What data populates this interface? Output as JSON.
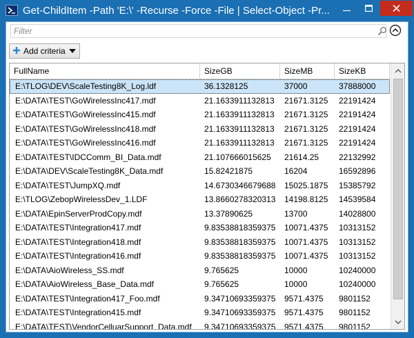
{
  "window": {
    "title": "Get-ChildItem -Path 'E:\\' -Recurse -Force -File | Select-Object -Pr...",
    "controls": [
      "minimize",
      "maximize",
      "close"
    ]
  },
  "filter": {
    "placeholder": "Filter"
  },
  "toolbar": {
    "add_criteria_label": "Add criteria"
  },
  "grid": {
    "columns": [
      "FullName",
      "SizeGB",
      "SizeMB",
      "SizeKB"
    ],
    "selected_row": 0,
    "rows": [
      [
        "E:\\TLOG\\DEV\\ScaleTesting8K_Log.ldf",
        "36.1328125",
        "37000",
        "37888000"
      ],
      [
        "E:\\DATA\\TEST\\GoWirelessInc417.mdf",
        "21.1633911132813",
        "21671.3125",
        "22191424"
      ],
      [
        "E:\\DATA\\TEST\\GoWirelessInc415.mdf",
        "21.1633911132813",
        "21671.3125",
        "22191424"
      ],
      [
        "E:\\DATA\\TEST\\GoWirelessInc418.mdf",
        "21.1633911132813",
        "21671.3125",
        "22191424"
      ],
      [
        "E:\\DATA\\TEST\\GoWirelessInc416.mdf",
        "21.1633911132813",
        "21671.3125",
        "22191424"
      ],
      [
        "E:\\DATA\\TEST\\IDCComm_BI_Data.mdf",
        "21.107666015625",
        "21614.25",
        "22132992"
      ],
      [
        "E:\\DATA\\DEV\\ScaleTesting8K_Data.mdf",
        "15.82421875",
        "16204",
        "16592896"
      ],
      [
        "E:\\DATA\\TEST\\JumpXQ.mdf",
        "14.6730346679688",
        "15025.1875",
        "15385792"
      ],
      [
        "E:\\TLOG\\ZebopWirelessDev_1.LDF",
        "13.8660278320313",
        "14198.8125",
        "14539584"
      ],
      [
        "E:\\DATA\\EpinServerProdCopy.mdf",
        "13.37890625",
        "13700",
        "14028800"
      ],
      [
        "E:\\DATA\\TEST\\Integration417.mdf",
        "9.83538818359375",
        "10071.4375",
        "10313152"
      ],
      [
        "E:\\DATA\\TEST\\Integration418.mdf",
        "9.83538818359375",
        "10071.4375",
        "10313152"
      ],
      [
        "E:\\DATA\\TEST\\Integration416.mdf",
        "9.83538818359375",
        "10071.4375",
        "10313152"
      ],
      [
        "E:\\DATA\\AioWireless_SS.mdf",
        "9.765625",
        "10000",
        "10240000"
      ],
      [
        "E:\\DATA\\AioWireless_Base_Data.mdf",
        "9.765625",
        "10000",
        "10240000"
      ],
      [
        "E:\\DATA\\TEST\\Integration417_Foo.mdf",
        "9.34710693359375",
        "9571.4375",
        "9801152"
      ],
      [
        "E:\\DATA\\TEST\\Integration415.mdf",
        "9.34710693359375",
        "9571.4375",
        "9801152"
      ],
      [
        "E:\\DATA\\TEST\\VendorCelluarSupport_Data.mdf",
        "9.34710693359375",
        "9571.4375",
        "9801152"
      ]
    ]
  },
  "icons": {
    "app": "powershell-icon",
    "search": "search-icon",
    "collapse": "chevron-up-circle-icon",
    "add": "plus-icon",
    "dropdown": "caret-down-icon"
  },
  "colors": {
    "titlebar": "#1b6fb3",
    "close_button": "#c42b1c",
    "selected_row": "#cce4f7",
    "add_icon": "#2b8ad8"
  }
}
